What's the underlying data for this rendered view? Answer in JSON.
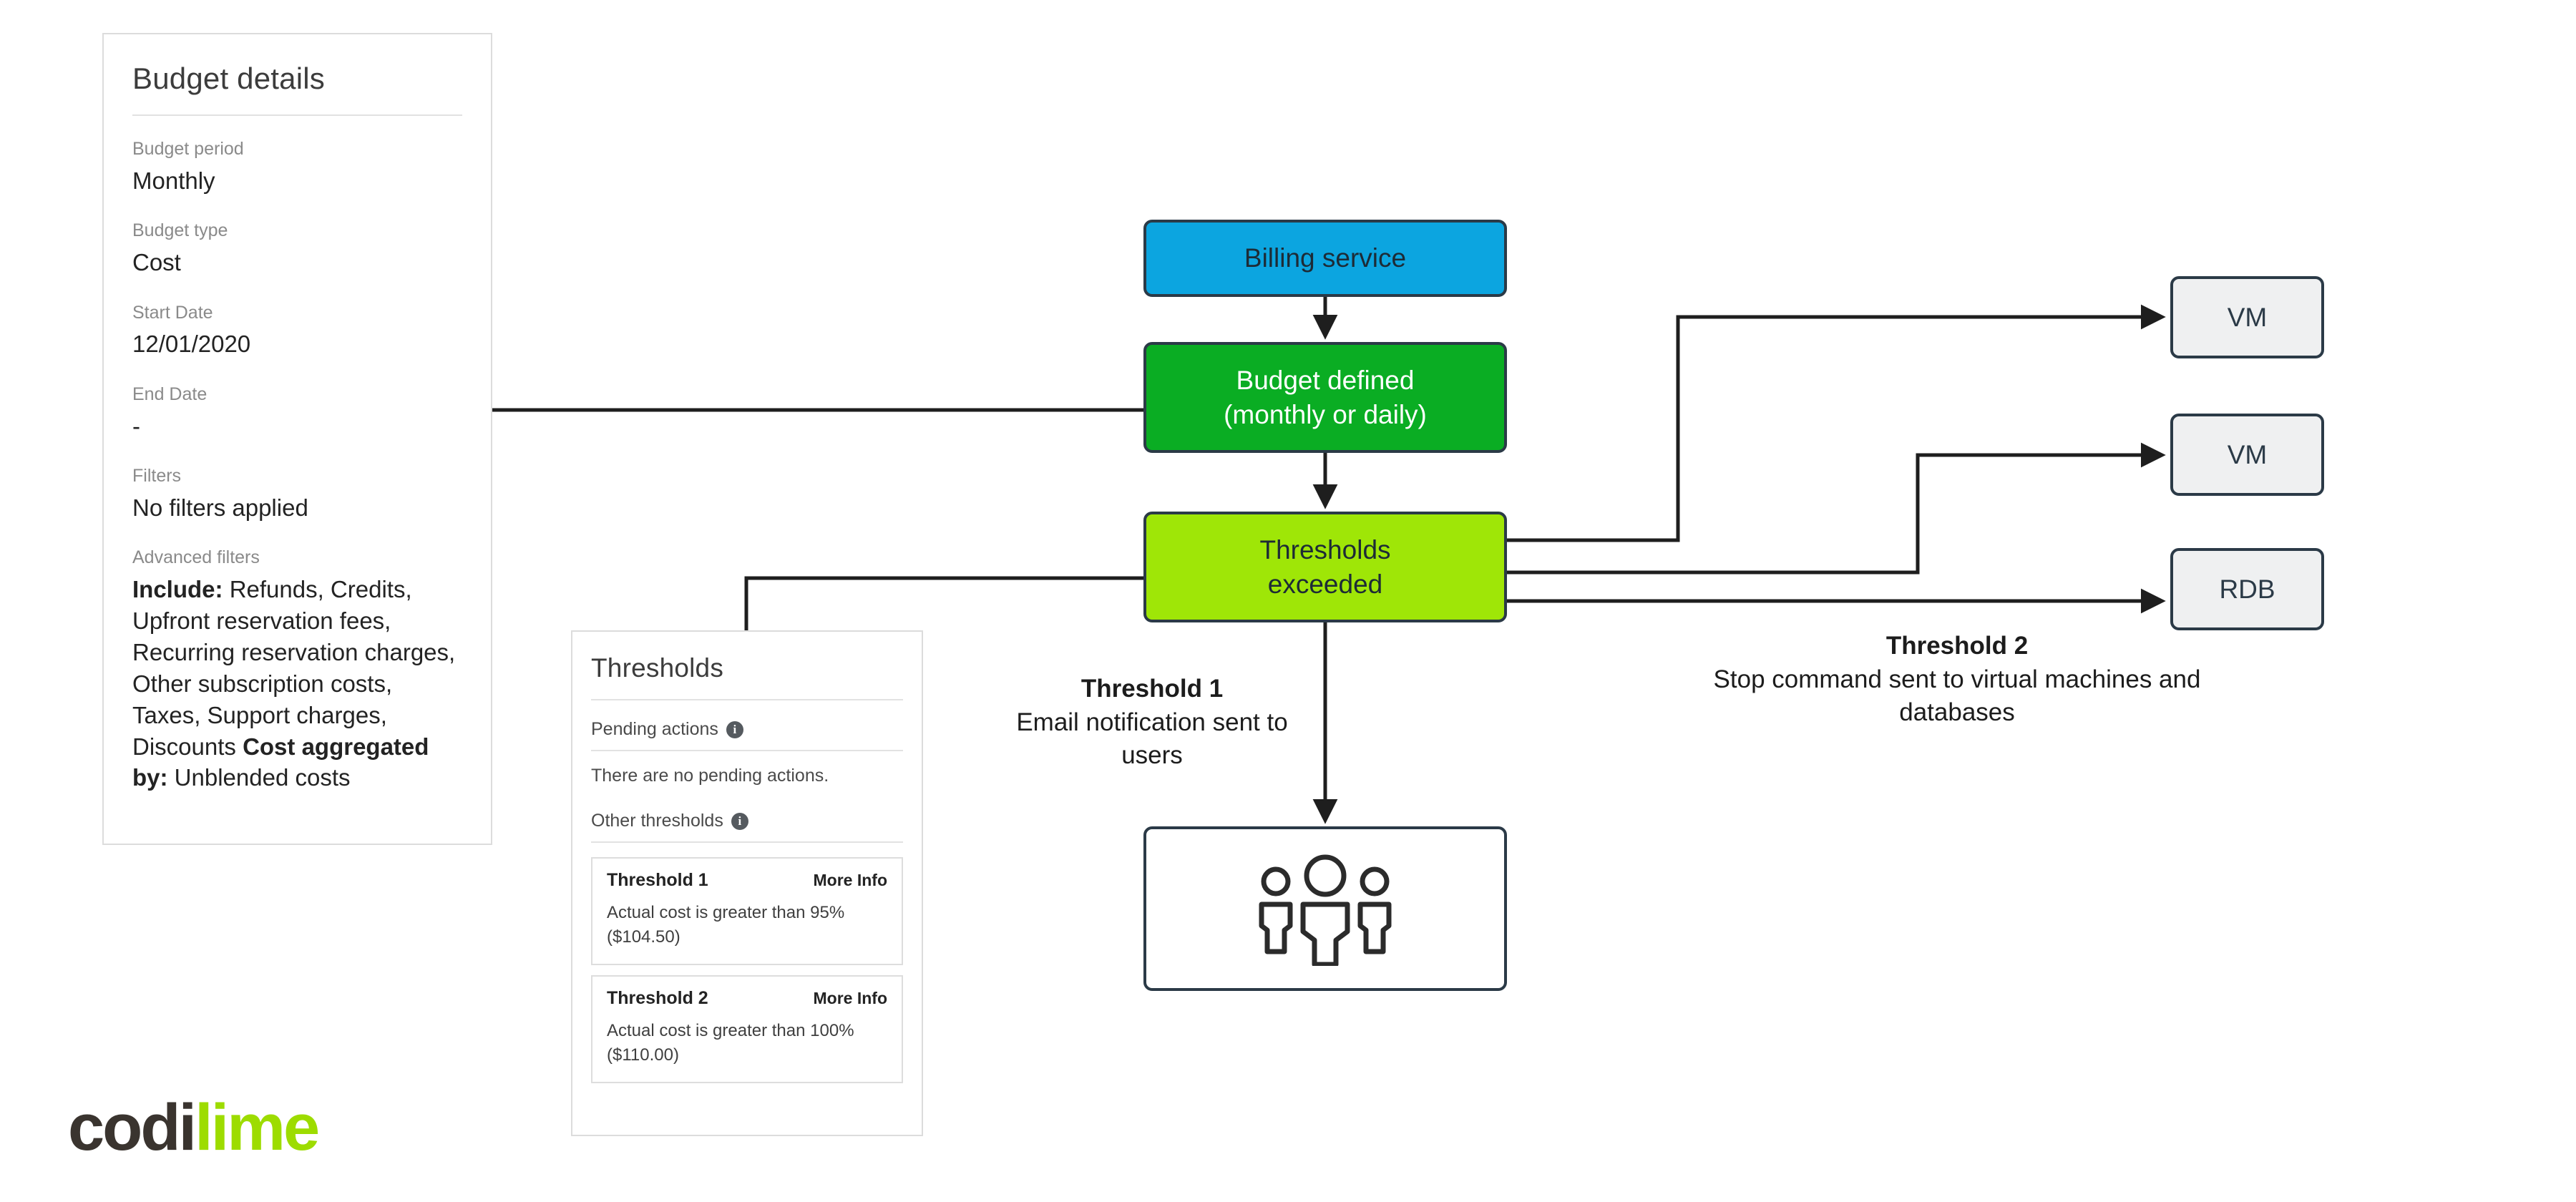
{
  "budget_panel": {
    "title": "Budget details",
    "fields": [
      {
        "label": "Budget period",
        "value": "Monthly"
      },
      {
        "label": "Budget type",
        "value": "Cost"
      },
      {
        "label": "Start Date",
        "value": "12/01/2020"
      },
      {
        "label": "End Date",
        "value": "-"
      },
      {
        "label": "Filters",
        "value": "No filters applied"
      }
    ],
    "advanced": {
      "label": "Advanced filters",
      "include_label": "Include:",
      "include_value": "Refunds, Credits, Upfront reservation fees, Recurring reservation charges, Other subscription costs, Taxes, Support charges, Discounts",
      "aggregate_label": "Cost aggregated by:",
      "aggregate_value": "Unblended costs"
    }
  },
  "thresholds_panel": {
    "title": "Thresholds",
    "pending_actions_label": "Pending actions",
    "pending_actions_empty": "There are no pending actions.",
    "other_thresholds_label": "Other thresholds",
    "info_glyph": "i",
    "cards": [
      {
        "title": "Threshold 1",
        "link": "More Info",
        "desc": "Actual cost is greater than 95% ($104.50)"
      },
      {
        "title": "Threshold 2",
        "link": "More Info",
        "desc": "Actual cost is greater than 100% ($110.00)"
      }
    ]
  },
  "flow": {
    "billing_service": "Billing service",
    "budget_defined_line1": "Budget defined",
    "budget_defined_line2": "(monthly or daily)",
    "thresholds_exceeded_line1": "Thresholds",
    "thresholds_exceeded_line2": "exceeded",
    "users_icon": "users-group-icon",
    "targets": [
      {
        "label": "VM"
      },
      {
        "label": "VM"
      },
      {
        "label": "RDB"
      }
    ]
  },
  "captions": {
    "threshold1": {
      "title": "Threshold  1",
      "body": "Email notification sent to users"
    },
    "threshold2": {
      "title": "Threshold  2",
      "body": "Stop command sent to virtual machines and databases"
    }
  },
  "logo": {
    "part1": "codi",
    "part2": "lime"
  },
  "colors": {
    "billing_blue": "#0CA5E0",
    "budget_green": "#0AAD23",
    "thresholds_lime": "#9FE607",
    "node_border": "#2B3A47",
    "target_fill": "#EFF0F1",
    "logo_lime": "#9DDC00",
    "logo_dark": "#3A342F",
    "panel_border": "#DCDCDC"
  }
}
